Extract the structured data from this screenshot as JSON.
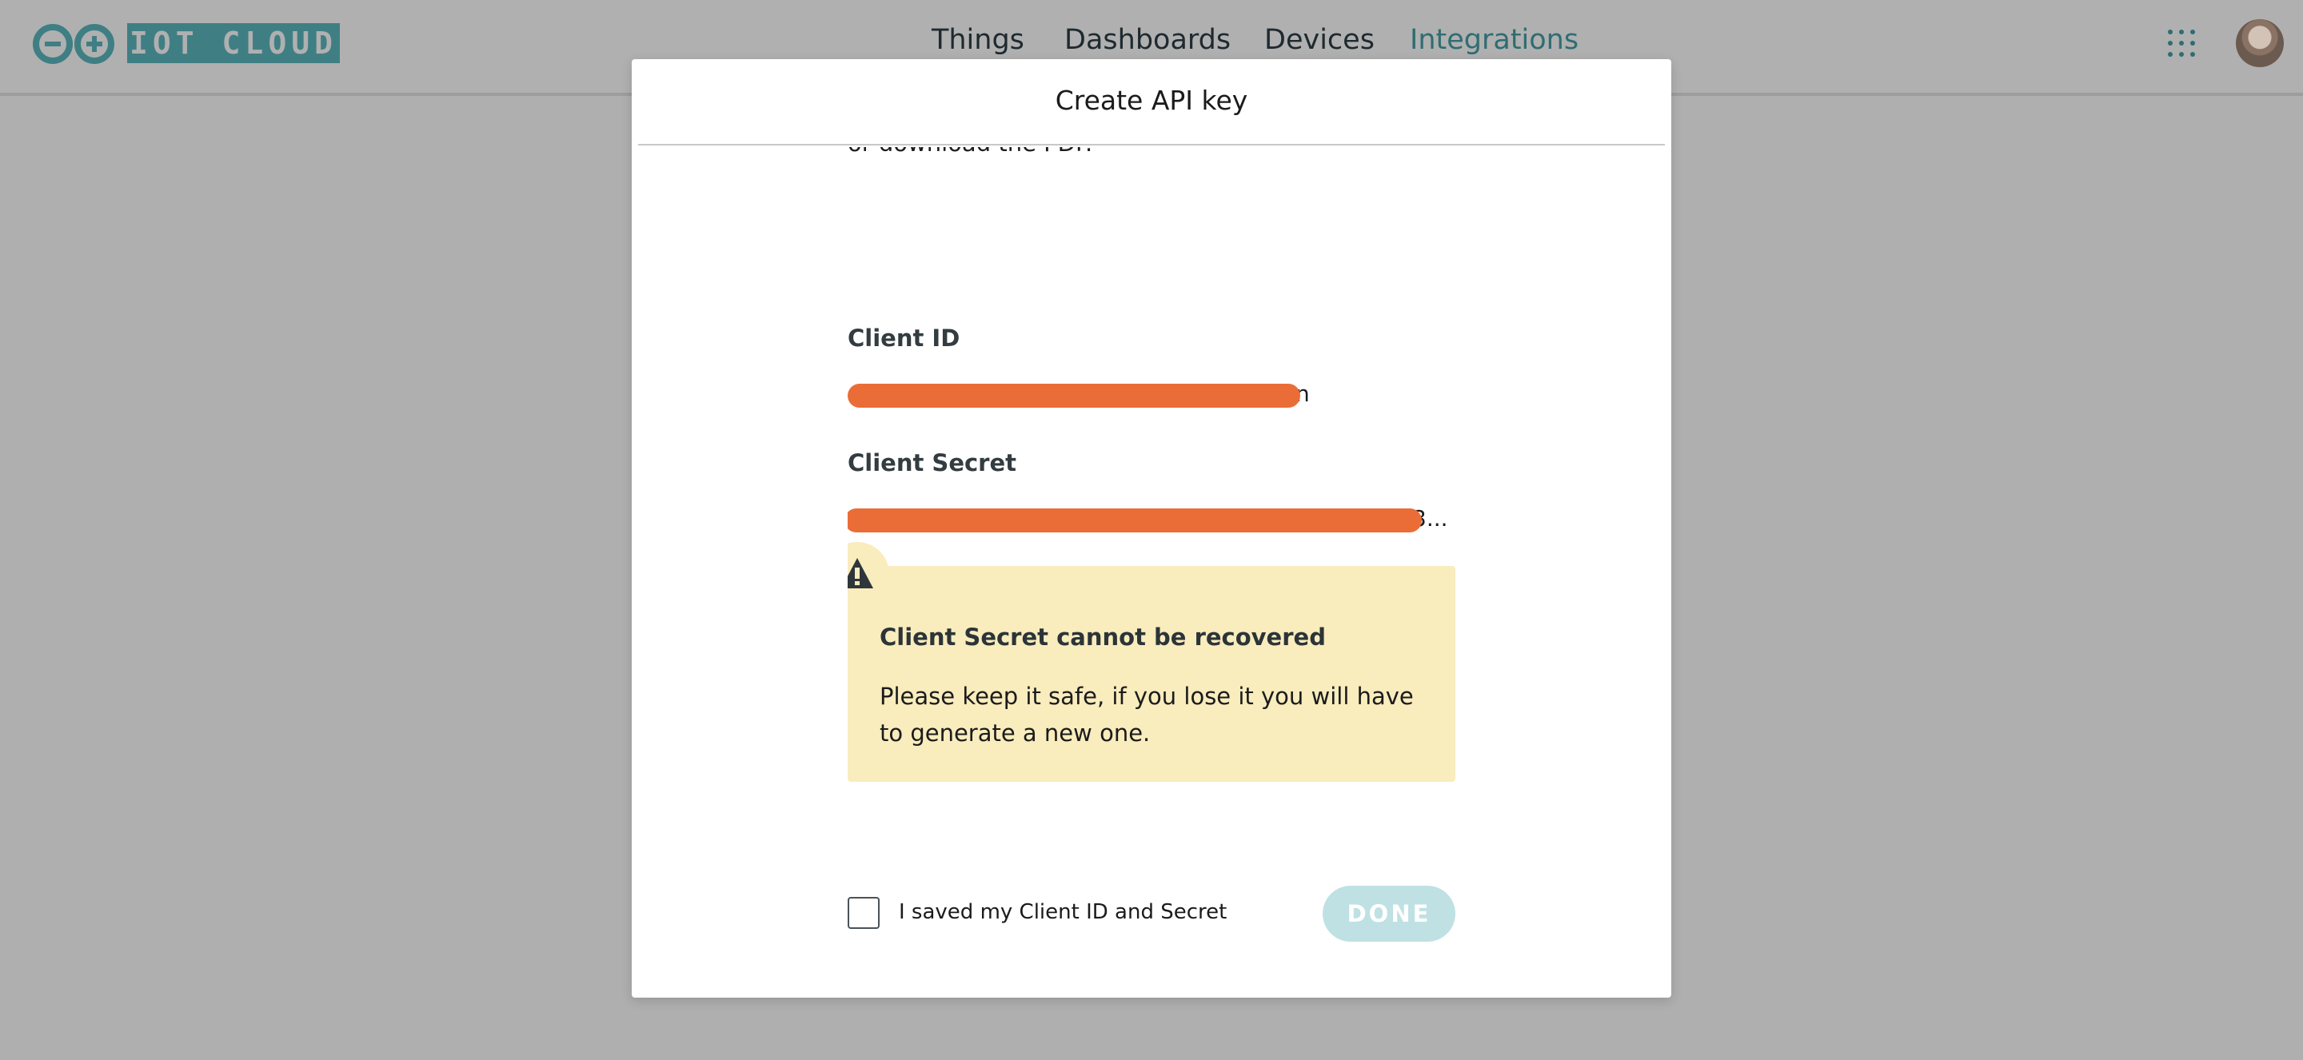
{
  "header": {
    "brand": "IOT CLOUD",
    "nav": [
      "Things",
      "Dashboards",
      "Devices",
      "Integrations"
    ],
    "active_nav": "Integrations",
    "apps_icon": "grid-icon",
    "avatar_icon": "user-avatar"
  },
  "modal": {
    "title": "Create API key",
    "intro_text": "ID and a Client Secret, please copy and save them or download the PDF.",
    "client_id_label": "Client ID",
    "client_id_value": "n",
    "client_secret_label": "Client Secret",
    "client_secret_value": "3...",
    "warning": {
      "icon": "warning-icon",
      "title": "Client Secret cannot be recovered",
      "body": "Please keep it safe, if you lose it you will have to generate a new one."
    },
    "checkbox_label": "I saved my Client ID and Secret",
    "done_label": "DONE"
  },
  "colors": {
    "overlay_bg": "#afafaf",
    "brand_teal": "#3f7f84",
    "redaction": "#ea6d37",
    "warning_bg": "#f9ecbd",
    "done_disabled": "#bfe1e3"
  }
}
